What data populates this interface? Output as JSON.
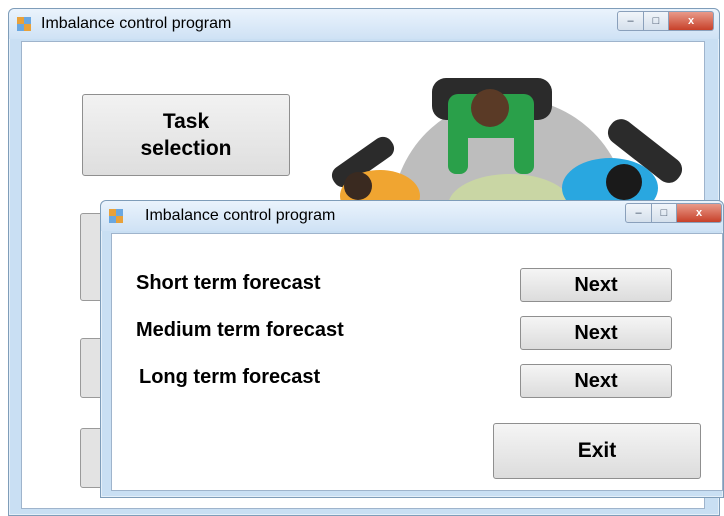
{
  "main_window": {
    "title": "Imbalance control program",
    "task_button_label": "Task\nselection",
    "controls": {
      "minimize": "–",
      "maximize": "□",
      "close": "x"
    }
  },
  "dialog": {
    "title": "Imbalance control program",
    "controls": {
      "minimize": "–",
      "maximize": "□",
      "close": "x"
    },
    "rows": [
      {
        "label": "Short term forecast",
        "button": "Next"
      },
      {
        "label": "Medium term forecast",
        "button": "Next"
      },
      {
        "label": "Long term forecast",
        "button": "Next"
      }
    ],
    "exit_label": "Exit"
  },
  "colors": {
    "titlebar": "#cfe2f5",
    "close_button": "#c7412a",
    "button_face": "#e3e3e3"
  },
  "illustration": {
    "icon": "team-meeting-top-view-illustration"
  }
}
